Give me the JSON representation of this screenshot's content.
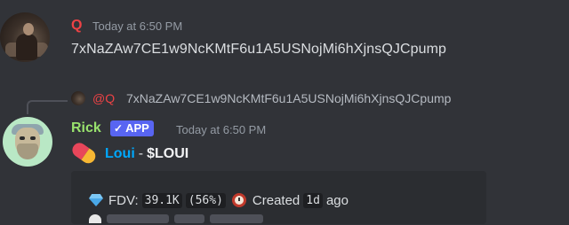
{
  "message1": {
    "author": "Q",
    "timestamp": "Today at 6:50 PM",
    "content": "7xNaZAw7CE1w9NcKMtF6u1A5USNojMi6hXjnsQJCpump",
    "author_color": "#ed4245"
  },
  "reply": {
    "mention": "@Q",
    "text": "7xNaZAw7CE1w9NcKMtF6u1A5USNojMi6hXjnsQJCpump"
  },
  "message2": {
    "author": "Rick",
    "author_color": "#99e26d",
    "badge": "APP",
    "badge_check": "✓",
    "timestamp": "Today at 6:50 PM",
    "token_name": "Loui",
    "separator": "-",
    "ticker": "$LOUI",
    "embed": {
      "fdv_label": "FDV:",
      "fdv_value": "39.1K",
      "fdv_change": "(56%)",
      "created_label": "Created",
      "created_value": "1d",
      "created_suffix": "ago"
    }
  },
  "colors": {
    "background": "#313338",
    "accent": "#5865f2",
    "link": "#00a8fc"
  }
}
